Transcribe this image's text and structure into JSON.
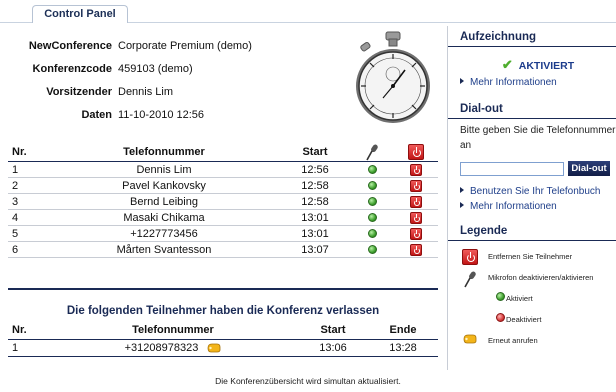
{
  "tab": {
    "label": "Control Panel"
  },
  "info": {
    "rows": [
      {
        "key": "NewConference",
        "value": "Corporate Premium (demo)"
      },
      {
        "key": "Konferenzcode",
        "value": "459103 (demo)"
      },
      {
        "key": "Vorsitzender",
        "value": "Dennis Lim"
      },
      {
        "key": "Daten",
        "value": "11-10-2010 12:56"
      }
    ]
  },
  "participants": {
    "headers": {
      "nr": "Nr.",
      "tel": "Telefonnummer",
      "start": "Start"
    },
    "rows": [
      {
        "nr": "1",
        "tel": "Dennis Lim",
        "start": "12:56",
        "mic": "active"
      },
      {
        "nr": "2",
        "tel": "Pavel Kankovsky",
        "start": "12:58",
        "mic": "active"
      },
      {
        "nr": "3",
        "tel": "Bernd Leibing",
        "start": "12:58",
        "mic": "active"
      },
      {
        "nr": "4",
        "tel": "Masaki Chikama",
        "start": "13:01",
        "mic": "active"
      },
      {
        "nr": "5",
        "tel": "+1227773456",
        "start": "13:01",
        "mic": "active"
      },
      {
        "nr": "6",
        "tel": "Mårten Svantesson",
        "start": "13:07",
        "mic": "active"
      }
    ]
  },
  "left": {
    "title": "Die folgenden Teilnehmer haben die Konferenz verlassen",
    "headers": {
      "nr": "Nr.",
      "tel": "Telefonnummer",
      "start": "Start",
      "end": "Ende"
    },
    "rows": [
      {
        "nr": "1",
        "tel": "+31208978323",
        "start": "13:06",
        "end": "13:28"
      }
    ]
  },
  "footer": "Die Konferenzübersicht wird simultan aktualisiert.",
  "sidebar": {
    "recording": {
      "title": "Aufzeichnung",
      "status": "AKTIVIERT",
      "more": "Mehr Informationen"
    },
    "dialout": {
      "title": "Dial-out",
      "text": "Bitte geben Sie die Telefonnummer an",
      "input_value": "",
      "button": "Dial-out",
      "use_phonebook": "Benutzen Sie Ihr Telefonbuch",
      "more": "Mehr Informationen"
    },
    "legend": {
      "title": "Legende",
      "remove": "Entfernen Sie Teilnehmer",
      "mic": "Mikrofon deaktivieren/aktivieren",
      "active": "Aktiviert",
      "inactive": "Deaktiviert",
      "recall": "Erneut anrufen"
    }
  },
  "colors": {
    "accent": "#1a2a55",
    "active": "#3fa12e",
    "inactive": "#d63b3b",
    "remove": "#c21616"
  }
}
